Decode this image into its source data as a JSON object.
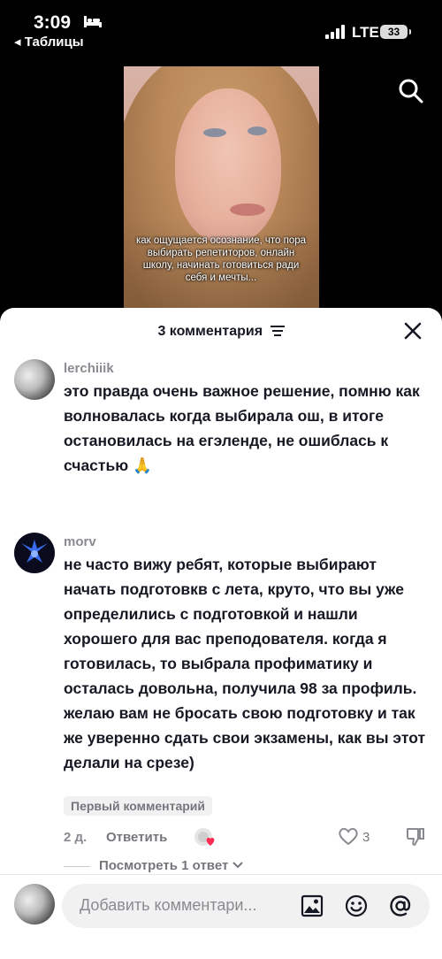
{
  "status_bar": {
    "time": "3:09",
    "back_label": "◂ Таблицы",
    "network": "LTE",
    "battery": "33"
  },
  "video": {
    "caption": "как ощущается осознание, что пора выбирать репетиторов, онлайн школу, начинать готовиться ради себя и мечты..."
  },
  "comments_panel": {
    "title": "3 комментария"
  },
  "comments": [
    {
      "username": "lerchiiik",
      "text": "это правда очень важное решение, помню как волновалась когда выбирала ош, в итоге остановилась на егэленде, не ошиблась к счастью 🙏"
    },
    {
      "username": "morv",
      "text": "не часто вижу ребят, которые выбирают начать подготовкв с лета, круто, что вы уже определились с подготовкой и нашли хорошего для вас преподователя. когда я готовилась, то выбрала профиматику и осталась довольна, получила 98 за профиль. желаю вам не бросать свою подготовку и так же уверенно сдать свои экзамены, как вы этот делали на срезе)",
      "badge": "Первый комментарий",
      "time": "2 д.",
      "reply_label": "Ответить",
      "likes": "3",
      "view_replies": "Посмотреть 1 ответ"
    }
  ],
  "composer": {
    "placeholder": "Добавить комментари..."
  },
  "icons": {
    "search": "search-icon",
    "close": "close-icon",
    "filter": "filter-icon",
    "like": "heart-outline-icon",
    "dislike": "thumbs-down-icon",
    "image": "image-icon",
    "emoji": "emoji-icon",
    "mention": "at-icon"
  }
}
